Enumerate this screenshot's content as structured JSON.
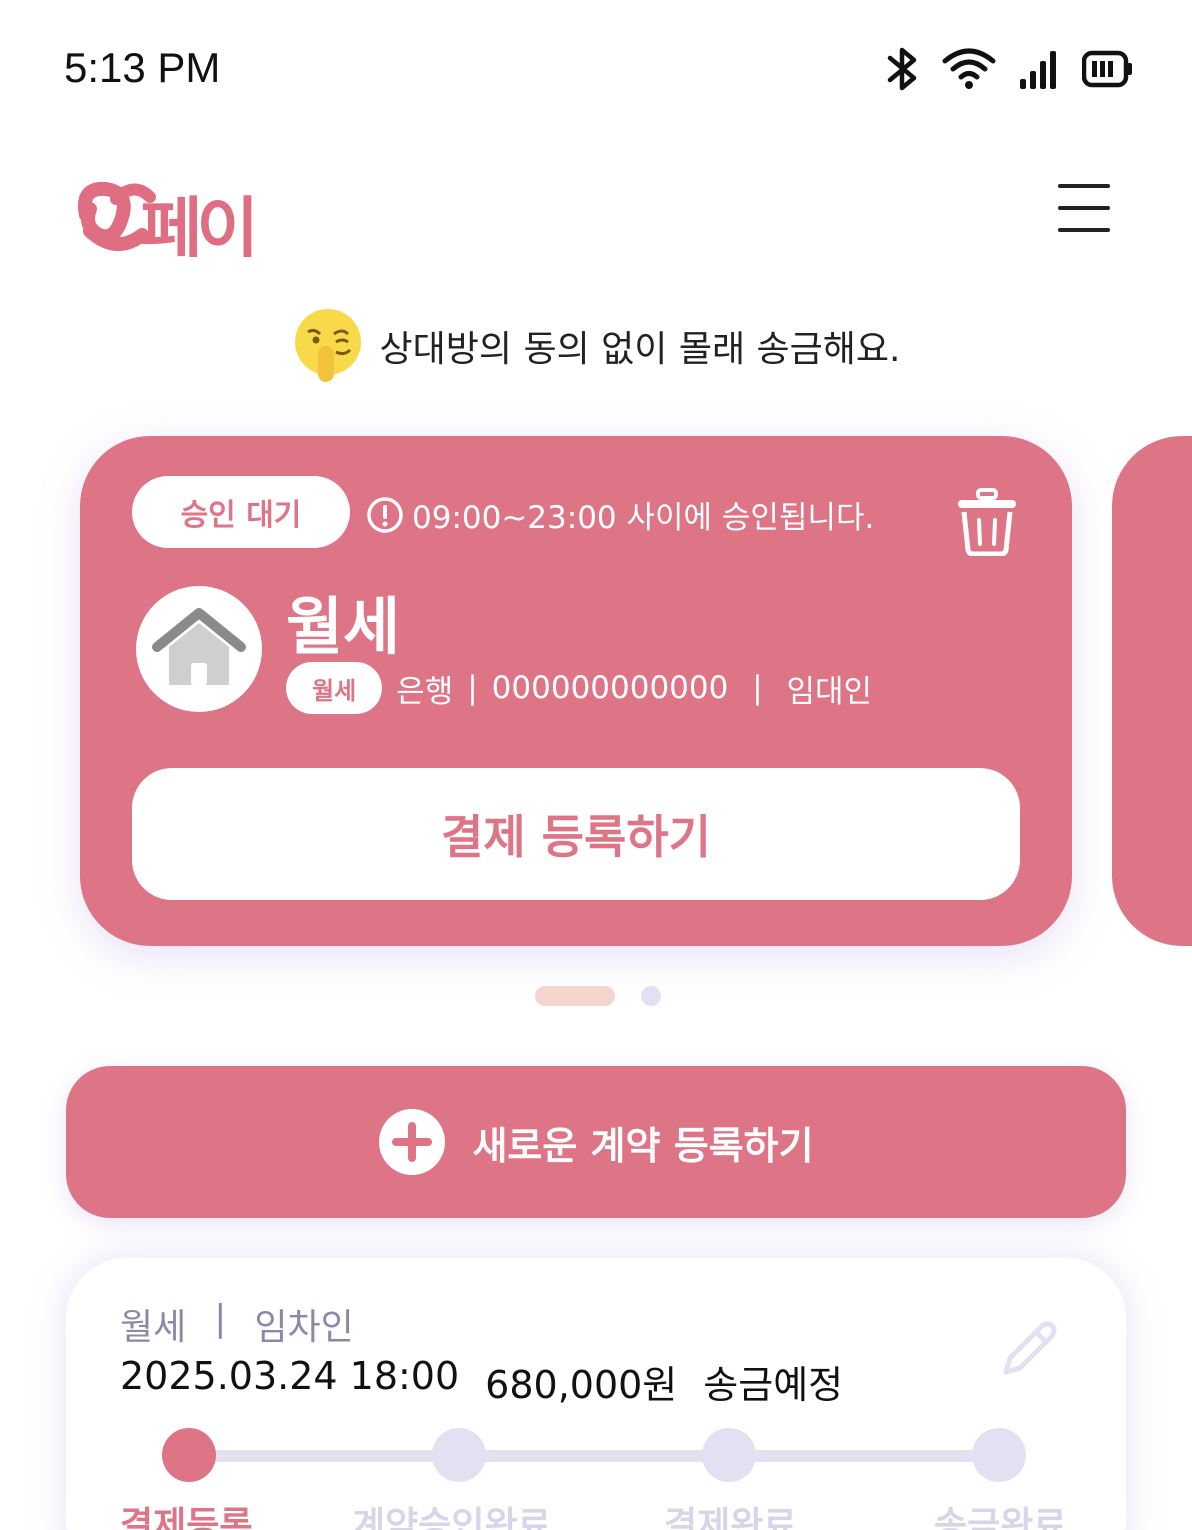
{
  "status_bar": {
    "time": "5:13 PM"
  },
  "header": {
    "logo": "ᴑ페이"
  },
  "notice": {
    "text": "상대방의 동의 없이 몰래 송금해요."
  },
  "card": {
    "status": "승인 대기",
    "approval_note": "09:00~23:00 사이에 승인됩니다.",
    "title": "월세",
    "type_badge": "월세",
    "bank": "은행",
    "account": "000000000000",
    "role": "임대인",
    "pay_button": "결제 등록하기"
  },
  "carousel": {
    "current": 1,
    "total": 2
  },
  "new_contract_button": "새로운 계약 등록하기",
  "schedule": {
    "type": "월세",
    "role": "임차인",
    "datetime": "2025.03.24 18:00",
    "amount": "680,000원",
    "status": "송금예정",
    "steps": [
      "결제등록",
      "계약승인완료",
      "결제완료",
      "송금완료"
    ],
    "active_step": 1
  },
  "colors": {
    "accent": "#de7586",
    "muted": "#e3e1f1",
    "dot_active": "#f5d6ce"
  }
}
